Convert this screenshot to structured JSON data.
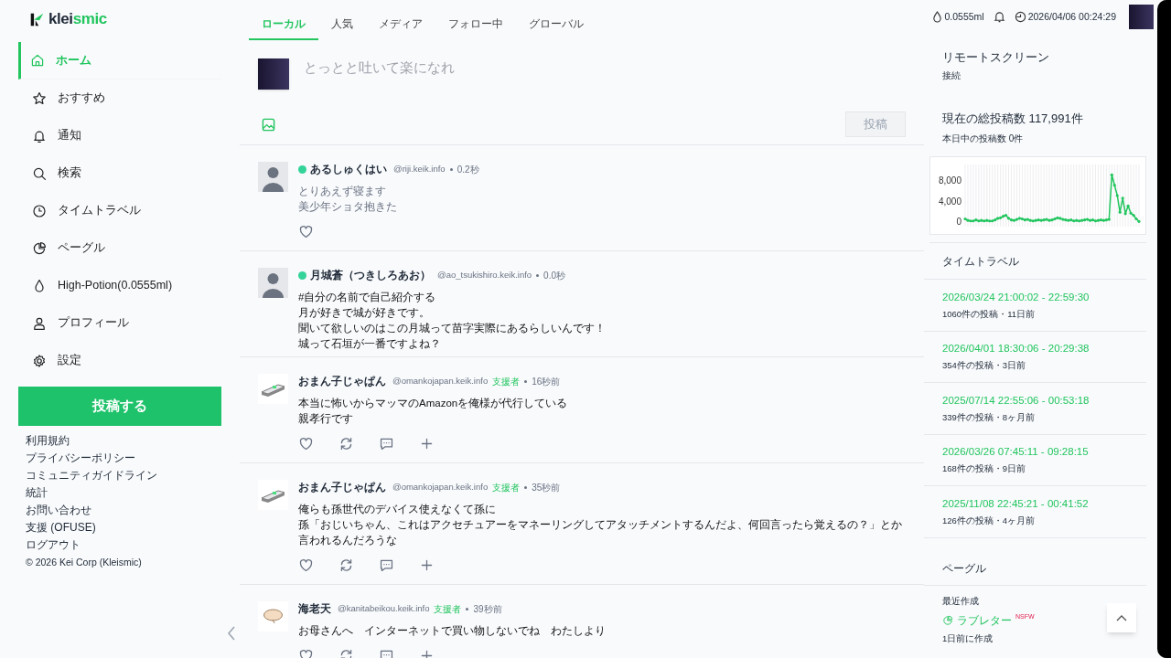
{
  "logo": {
    "prefix": "klei",
    "suffix": "smic"
  },
  "nav": [
    {
      "label": "ホーム",
      "selected": true
    },
    {
      "label": "おすすめ",
      "selected": false
    },
    {
      "label": "通知",
      "selected": false
    },
    {
      "label": "検索",
      "selected": false
    },
    {
      "label": "タイムトラベル",
      "selected": false
    },
    {
      "label": "ペーグル",
      "selected": false
    },
    {
      "label": "High-Potion(0.0555ml)",
      "selected": false
    },
    {
      "label": "プロフィール",
      "selected": false
    },
    {
      "label": "設定",
      "selected": false
    }
  ],
  "post_button": "投稿する",
  "footer_links": [
    "利用規約",
    "プライバシーポリシー",
    "コミュニティガイドライン",
    "統計",
    "お問い合わせ",
    "支援 (OFUSE)",
    "ログアウト"
  ],
  "copyright": "© 2026 Kei Corp (Kleismic)",
  "tabs": [
    {
      "label": "ローカル",
      "selected": true
    },
    {
      "label": "人気",
      "selected": false
    },
    {
      "label": "メディア",
      "selected": false
    },
    {
      "label": "フォロー中",
      "selected": false
    },
    {
      "label": "グローバル",
      "selected": false
    }
  ],
  "composer": {
    "placeholder": "とっとと吐いて楽になれ",
    "submit": "投稿"
  },
  "posts": [
    {
      "kind": "like_only",
      "online": true,
      "name": "あるしゅくはい",
      "handle": "@riji.keik.info",
      "time": "0.2秒",
      "muted": true,
      "lines": [
        "とりあえず寝ます",
        "美少年ショタ抱きた"
      ]
    },
    {
      "kind": "clipped",
      "online": true,
      "name": "月城蒼（つきしろあお）",
      "handle": "@ao_tsukishiro.keik.info",
      "time": "0.0秒",
      "muted": false,
      "lines": [
        "#自分の名前で自己紹介する",
        "月が好きで城が好きです。",
        "聞いて欲しいのはこの月城って苗字実際にあるらしいんです！",
        "城って石垣が一番ですよね？"
      ]
    },
    {
      "kind": "full",
      "online": false,
      "name": "おまん子じゃぱん",
      "handle": "@omankojapan.keik.info",
      "badge": "支援者",
      "time": "16秒前",
      "muted": false,
      "lines": [
        "本当に怖いからマッマのAmazonを俺様が代行している",
        "親孝行です"
      ]
    },
    {
      "kind": "full",
      "online": false,
      "name": "おまん子じゃぱん",
      "handle": "@omankojapan.keik.info",
      "badge": "支援者",
      "time": "35秒前",
      "muted": false,
      "lines": [
        "俺らも孫世代のデバイス使えなくて孫に",
        "孫「おじいちゃん、これはアクセチュアーをマネーリングしてアタッチメントするんだよ、何回言ったら覚えるの？」とか言われるんだろうな"
      ]
    },
    {
      "kind": "full",
      "online": false,
      "name": "海老天",
      "handle": "@kanitabeikou.keik.info",
      "badge": "支援者",
      "time": "39秒前",
      "muted": false,
      "lines": [
        "お母さんへ　インターネットで買い物しないでね　わたしより"
      ]
    }
  ],
  "topbar": {
    "potion": "0.0555ml",
    "datetime": "2026/04/06 00:24:29"
  },
  "remote": {
    "title": "リモートスクリーン",
    "status": "接続"
  },
  "stats": {
    "total": "現在の総投稿数 117,991件",
    "today": "本日中の投稿数 0件",
    "chart_data": {
      "type": "line",
      "yticks": [
        0,
        {
          "value": 4000,
          "label": "4,000"
        },
        {
          "value": 8000,
          "label": "8,000"
        }
      ],
      "ylim": [
        -1000,
        11000
      ],
      "series": [
        {
          "color": "#22c55e",
          "values": [
            500,
            200,
            100,
            100,
            300,
            100,
            200,
            100,
            200,
            100,
            100,
            300,
            600,
            700,
            1000,
            1200,
            600,
            300,
            200,
            400,
            600,
            500,
            300,
            400,
            200,
            100,
            200,
            300,
            200,
            300,
            400,
            200,
            300,
            500,
            700,
            600,
            400,
            300,
            200,
            300,
            100,
            200,
            100,
            200,
            300,
            400,
            200,
            300,
            100,
            200,
            300,
            200,
            300,
            400,
            9000,
            7000,
            5000,
            1800,
            4500,
            1500,
            3000,
            1600,
            1200,
            500,
            0
          ]
        }
      ]
    }
  },
  "timetravel": {
    "title": "タイムトラベル",
    "items": [
      {
        "range": "2026/03/24 21:00:02 - 22:59:30",
        "meta": "1060件の投稿・11日前"
      },
      {
        "range": "2026/04/01 18:30:06 - 20:29:38",
        "meta": "354件の投稿・3日前"
      },
      {
        "range": "2025/07/14 22:55:06 - 00:53:18",
        "meta": "339件の投稿・8ヶ月前"
      },
      {
        "range": "2026/03/26 07:45:11 - 09:28:15",
        "meta": "168件の投稿・9日前"
      },
      {
        "range": "2025/11/08 22:45:21 - 00:41:52",
        "meta": "126件の投稿・4ヶ月前"
      }
    ]
  },
  "pagel": {
    "title": "ペーグル",
    "recent_label": "最近作成",
    "item": "ラブレター",
    "tag": "NSFW",
    "created": "1日前に作成"
  }
}
